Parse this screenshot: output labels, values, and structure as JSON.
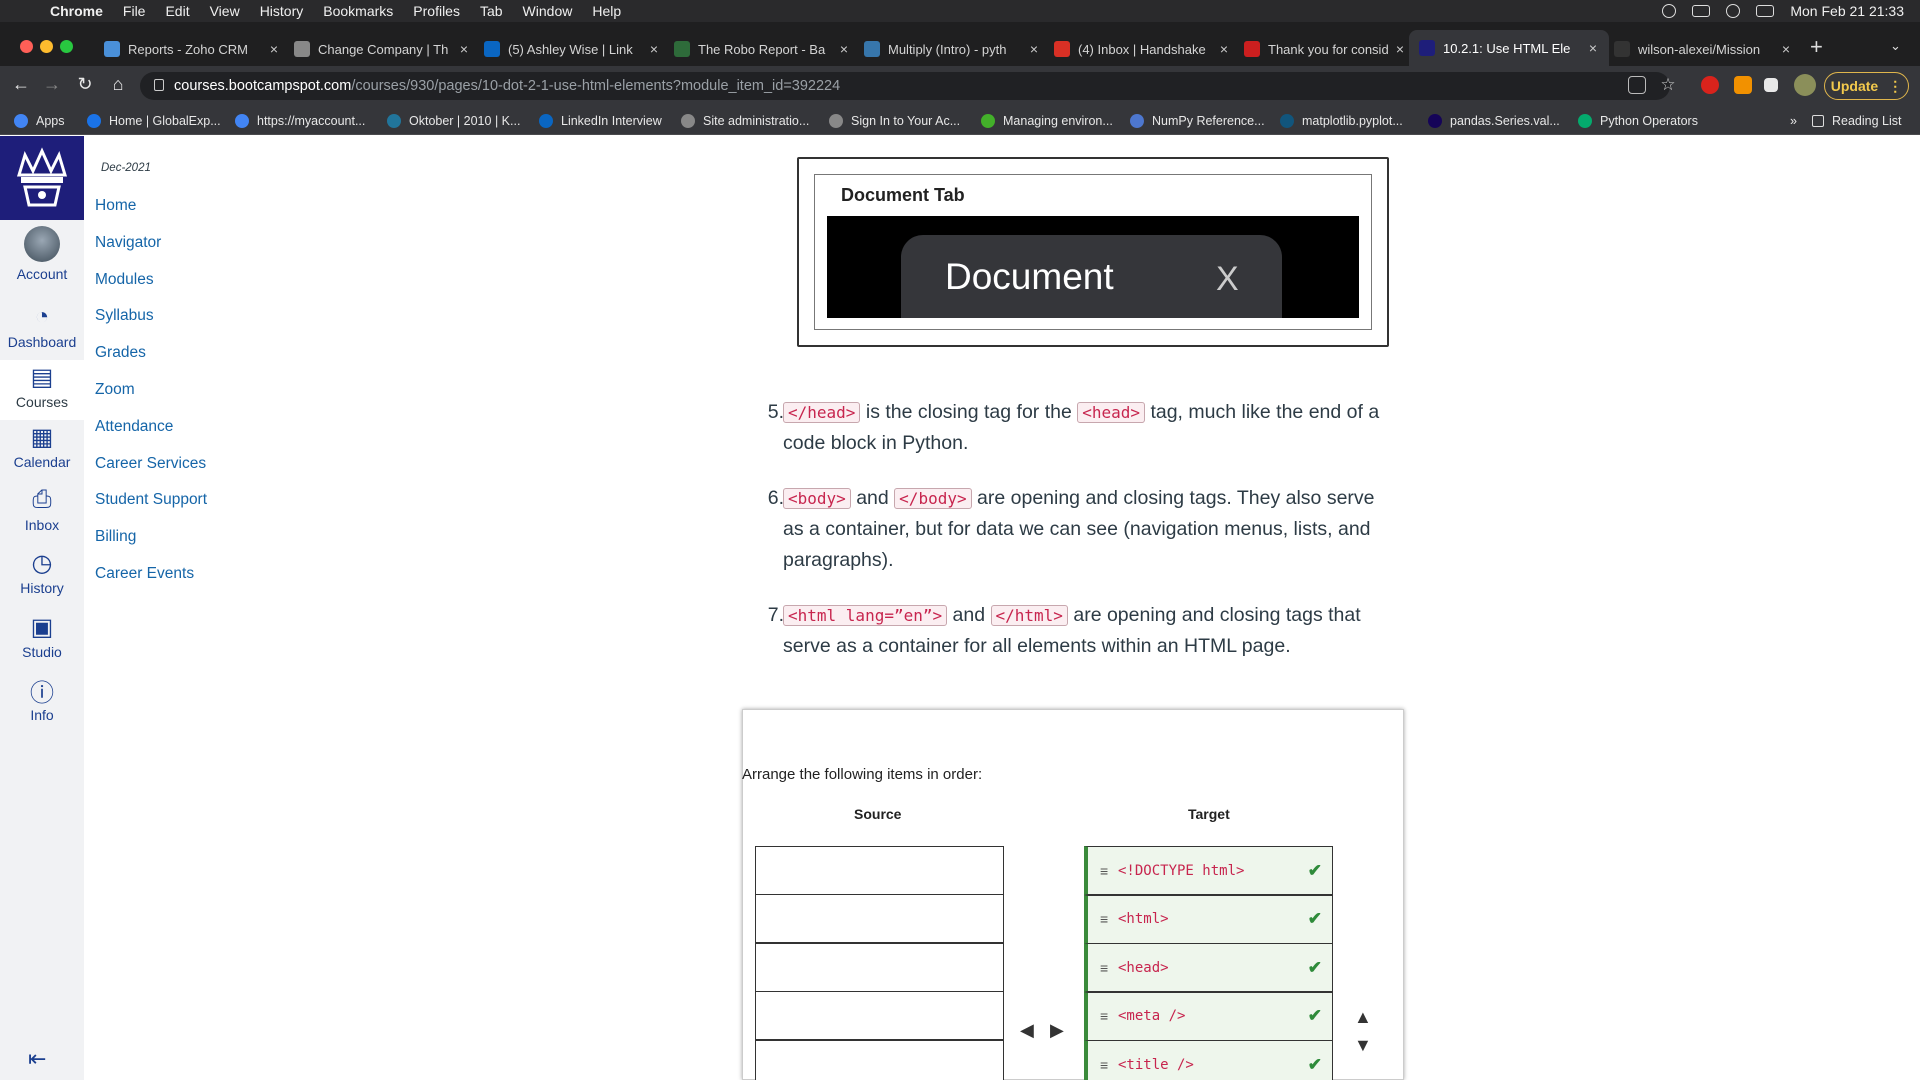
{
  "menubar": {
    "app": "Chrome",
    "items": [
      "File",
      "Edit",
      "View",
      "History",
      "Bookmarks",
      "Profiles",
      "Tab",
      "Window",
      "Help"
    ],
    "clock": "Mon Feb 21  21:33"
  },
  "tabs": [
    {
      "title": "Reports - Zoho CRM",
      "icon": "zoho-icon",
      "color": "#4a90d9"
    },
    {
      "title": "Change Company | Th",
      "icon": "globe-icon",
      "color": "#888888"
    },
    {
      "title": "(5) Ashley Wise | Link",
      "icon": "linkedin-icon",
      "color": "#0a66c2"
    },
    {
      "title": "The Robo Report - Ba",
      "icon": "robo-icon",
      "color": "#2e6b3a"
    },
    {
      "title": "Multiply (Intro) - pyth",
      "icon": "python-icon",
      "color": "#3776ab"
    },
    {
      "title": "(4) Inbox | Handshake",
      "icon": "handshake-icon",
      "color": "#d93025"
    },
    {
      "title": "Thank you for conside",
      "icon": "opera-icon",
      "color": "#cc1f1f"
    },
    {
      "title": "10.2.1: Use HTML Ele",
      "icon": "canvas-icon",
      "color": "#1e1e7a"
    },
    {
      "title": "wilson-alexei/Mission",
      "icon": "github-icon",
      "color": "#333333"
    }
  ],
  "address": {
    "host": "courses.bootcampspot.com",
    "path": "/courses/930/pages/10-dot-2-1-use-html-elements?module_item_id=392224"
  },
  "update_label": "Update",
  "bookmarks": [
    {
      "label": "Apps",
      "color": "#4285f4"
    },
    {
      "label": "Home | GlobalExp...",
      "color": "#1a73e8"
    },
    {
      "label": "https://myaccount...",
      "color": "#4285f4"
    },
    {
      "label": "Oktober | 2010 | K...",
      "color": "#21759b"
    },
    {
      "label": "LinkedIn Interview",
      "color": "#0a66c2"
    },
    {
      "label": "Site administratio...",
      "color": "#888888"
    },
    {
      "label": "Sign In to Your Ac...",
      "color": "#888888"
    },
    {
      "label": "Managing environ...",
      "color": "#43b02a"
    },
    {
      "label": "NumPy Reference...",
      "color": "#4d77cf"
    },
    {
      "label": "matplotlib.pyplot...",
      "color": "#11557c"
    },
    {
      "label": "pandas.Series.val...",
      "color": "#150458"
    },
    {
      "label": "Python Operators",
      "color": "#04aa6d"
    }
  ],
  "reading_list": "Reading List",
  "global_nav": [
    {
      "label": "Account",
      "icon": "avatar-icon"
    },
    {
      "label": "Dashboard",
      "icon": "dashboard-icon"
    },
    {
      "label": "Courses",
      "icon": "courses-icon"
    },
    {
      "label": "Calendar",
      "icon": "calendar-icon"
    },
    {
      "label": "Inbox",
      "icon": "inbox-icon"
    },
    {
      "label": "History",
      "icon": "clock-icon"
    },
    {
      "label": "Studio",
      "icon": "studio-icon"
    },
    {
      "label": "Info",
      "icon": "info-icon"
    }
  ],
  "course_nav": {
    "term": "Dec-2021",
    "items": [
      "Home",
      "Navigator",
      "Modules",
      "Syllabus",
      "Grades",
      "Zoom",
      "Attendance",
      "Career Services",
      "Student Support",
      "Billing",
      "Career Events"
    ]
  },
  "doc_tab": {
    "title": "Document Tab",
    "tab_label": "Document",
    "close": "X"
  },
  "list": [
    {
      "num": "5.",
      "c1": "</head>",
      "t1": " is the closing tag for the ",
      "c2": "<head>",
      "t2": " tag, much like the end of a code block in Python."
    },
    {
      "num": "6.",
      "c1": "<body>",
      "t1": " and ",
      "c2": "</body>",
      "t2": " are opening and closing tags. They also serve as a container, but for data we can see (navigation menus, lists, and paragraphs)."
    },
    {
      "num": "7.",
      "c1": "<html lang=”en”>",
      "t1": " and ",
      "c2": "</html>",
      "t2": " are opening and closing tags that serve as a container for all elements within an HTML page."
    }
  ],
  "quiz": {
    "prompt": "Arrange the following items in order:",
    "source_label": "Source",
    "target_label": "Target",
    "targets": [
      "<!DOCTYPE html>",
      "<html>",
      "<head>",
      "<meta />",
      "<title />"
    ]
  }
}
